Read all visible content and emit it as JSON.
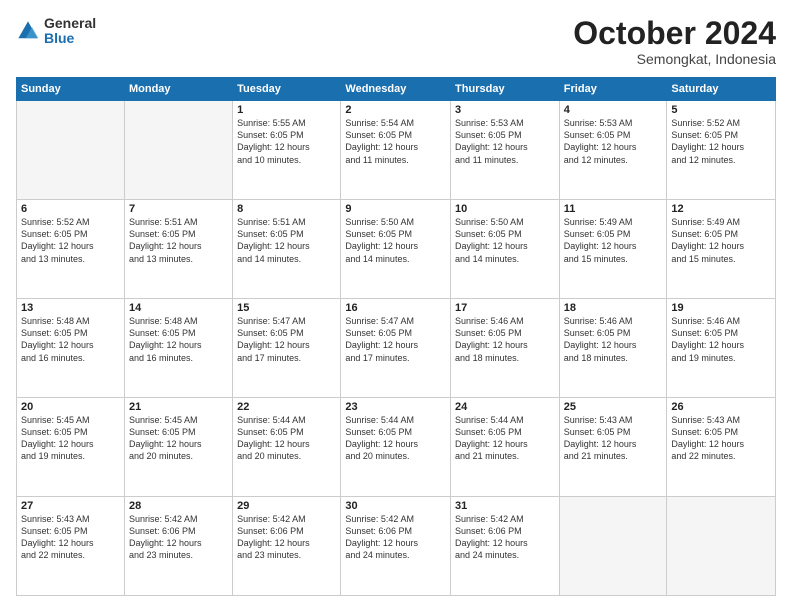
{
  "logo": {
    "general": "General",
    "blue": "Blue"
  },
  "title": "October 2024",
  "location": "Semongkat, Indonesia",
  "days_of_week": [
    "Sunday",
    "Monday",
    "Tuesday",
    "Wednesday",
    "Thursday",
    "Friday",
    "Saturday"
  ],
  "weeks": [
    [
      {
        "num": "",
        "info": "",
        "empty": true
      },
      {
        "num": "",
        "info": "",
        "empty": true
      },
      {
        "num": "1",
        "info": "Sunrise: 5:55 AM\nSunset: 6:05 PM\nDaylight: 12 hours\nand 10 minutes."
      },
      {
        "num": "2",
        "info": "Sunrise: 5:54 AM\nSunset: 6:05 PM\nDaylight: 12 hours\nand 11 minutes."
      },
      {
        "num": "3",
        "info": "Sunrise: 5:53 AM\nSunset: 6:05 PM\nDaylight: 12 hours\nand 11 minutes."
      },
      {
        "num": "4",
        "info": "Sunrise: 5:53 AM\nSunset: 6:05 PM\nDaylight: 12 hours\nand 12 minutes."
      },
      {
        "num": "5",
        "info": "Sunrise: 5:52 AM\nSunset: 6:05 PM\nDaylight: 12 hours\nand 12 minutes."
      }
    ],
    [
      {
        "num": "6",
        "info": "Sunrise: 5:52 AM\nSunset: 6:05 PM\nDaylight: 12 hours\nand 13 minutes."
      },
      {
        "num": "7",
        "info": "Sunrise: 5:51 AM\nSunset: 6:05 PM\nDaylight: 12 hours\nand 13 minutes."
      },
      {
        "num": "8",
        "info": "Sunrise: 5:51 AM\nSunset: 6:05 PM\nDaylight: 12 hours\nand 14 minutes."
      },
      {
        "num": "9",
        "info": "Sunrise: 5:50 AM\nSunset: 6:05 PM\nDaylight: 12 hours\nand 14 minutes."
      },
      {
        "num": "10",
        "info": "Sunrise: 5:50 AM\nSunset: 6:05 PM\nDaylight: 12 hours\nand 14 minutes."
      },
      {
        "num": "11",
        "info": "Sunrise: 5:49 AM\nSunset: 6:05 PM\nDaylight: 12 hours\nand 15 minutes."
      },
      {
        "num": "12",
        "info": "Sunrise: 5:49 AM\nSunset: 6:05 PM\nDaylight: 12 hours\nand 15 minutes."
      }
    ],
    [
      {
        "num": "13",
        "info": "Sunrise: 5:48 AM\nSunset: 6:05 PM\nDaylight: 12 hours\nand 16 minutes."
      },
      {
        "num": "14",
        "info": "Sunrise: 5:48 AM\nSunset: 6:05 PM\nDaylight: 12 hours\nand 16 minutes."
      },
      {
        "num": "15",
        "info": "Sunrise: 5:47 AM\nSunset: 6:05 PM\nDaylight: 12 hours\nand 17 minutes."
      },
      {
        "num": "16",
        "info": "Sunrise: 5:47 AM\nSunset: 6:05 PM\nDaylight: 12 hours\nand 17 minutes."
      },
      {
        "num": "17",
        "info": "Sunrise: 5:46 AM\nSunset: 6:05 PM\nDaylight: 12 hours\nand 18 minutes."
      },
      {
        "num": "18",
        "info": "Sunrise: 5:46 AM\nSunset: 6:05 PM\nDaylight: 12 hours\nand 18 minutes."
      },
      {
        "num": "19",
        "info": "Sunrise: 5:46 AM\nSunset: 6:05 PM\nDaylight: 12 hours\nand 19 minutes."
      }
    ],
    [
      {
        "num": "20",
        "info": "Sunrise: 5:45 AM\nSunset: 6:05 PM\nDaylight: 12 hours\nand 19 minutes."
      },
      {
        "num": "21",
        "info": "Sunrise: 5:45 AM\nSunset: 6:05 PM\nDaylight: 12 hours\nand 20 minutes."
      },
      {
        "num": "22",
        "info": "Sunrise: 5:44 AM\nSunset: 6:05 PM\nDaylight: 12 hours\nand 20 minutes."
      },
      {
        "num": "23",
        "info": "Sunrise: 5:44 AM\nSunset: 6:05 PM\nDaylight: 12 hours\nand 20 minutes."
      },
      {
        "num": "24",
        "info": "Sunrise: 5:44 AM\nSunset: 6:05 PM\nDaylight: 12 hours\nand 21 minutes."
      },
      {
        "num": "25",
        "info": "Sunrise: 5:43 AM\nSunset: 6:05 PM\nDaylight: 12 hours\nand 21 minutes."
      },
      {
        "num": "26",
        "info": "Sunrise: 5:43 AM\nSunset: 6:05 PM\nDaylight: 12 hours\nand 22 minutes."
      }
    ],
    [
      {
        "num": "27",
        "info": "Sunrise: 5:43 AM\nSunset: 6:05 PM\nDaylight: 12 hours\nand 22 minutes."
      },
      {
        "num": "28",
        "info": "Sunrise: 5:42 AM\nSunset: 6:06 PM\nDaylight: 12 hours\nand 23 minutes."
      },
      {
        "num": "29",
        "info": "Sunrise: 5:42 AM\nSunset: 6:06 PM\nDaylight: 12 hours\nand 23 minutes."
      },
      {
        "num": "30",
        "info": "Sunrise: 5:42 AM\nSunset: 6:06 PM\nDaylight: 12 hours\nand 24 minutes."
      },
      {
        "num": "31",
        "info": "Sunrise: 5:42 AM\nSunset: 6:06 PM\nDaylight: 12 hours\nand 24 minutes."
      },
      {
        "num": "",
        "info": "",
        "empty": true
      },
      {
        "num": "",
        "info": "",
        "empty": true
      }
    ]
  ]
}
